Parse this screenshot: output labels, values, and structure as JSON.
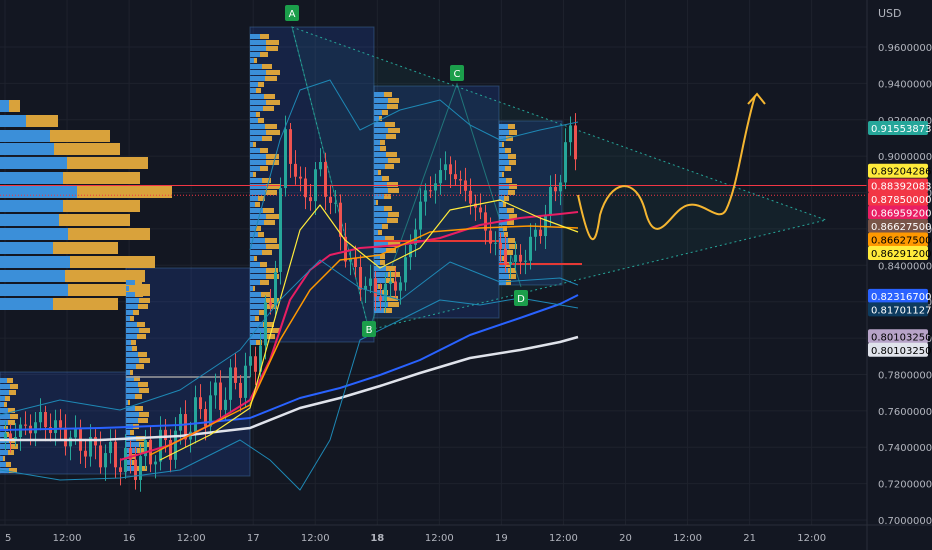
{
  "chart_data": {
    "type": "candlestick",
    "currency": "USD",
    "y_ticks": [
      "0.96000000",
      "0.94000000",
      "0.92000000",
      "0.90000000",
      "0.88000000",
      "0.86000000",
      "0.84000000",
      "0.82000000",
      "0.80000000",
      "0.78000000",
      "0.76000000",
      "0.74000000",
      "0.72000000",
      "0.70000000"
    ],
    "y_tick_values": [
      0.96,
      0.94,
      0.92,
      0.9,
      0.88,
      0.86,
      0.84,
      0.82,
      0.8,
      0.78,
      0.76,
      0.74,
      0.72,
      0.7
    ],
    "ylim": [
      0.699,
      0.968
    ],
    "x_ticks": [
      "5",
      "12:00",
      "16",
      "12:00",
      "17",
      "12:00",
      "18",
      "12:00",
      "19",
      "12:00",
      "20",
      "12:00",
      "21",
      "12:00"
    ],
    "x_tick_bold": [
      false,
      false,
      false,
      false,
      false,
      false,
      true,
      false,
      false,
      false,
      false,
      false,
      false,
      false
    ],
    "grid": true,
    "price_labels": [
      {
        "text": "0.91553873",
        "value": 0.9155,
        "color": "#26a69a",
        "fg": "#ffffff"
      },
      {
        "text": "0.89204286",
        "value": 0.892,
        "color": "#ffeb3b",
        "fg": "#000000"
      },
      {
        "text": "0.88392083",
        "value": 0.8839,
        "color": "#f23645",
        "fg": "#ffffff"
      },
      {
        "text": "0.87850000",
        "value": 0.8785,
        "color": "#f23645",
        "fg": "#ffffff"
      },
      {
        "text": "0.86959200",
        "value": 0.8696,
        "color": "#e91e63",
        "fg": "#ffffff"
      },
      {
        "text": "0.86627500",
        "value": 0.8663,
        "color": "#795548",
        "fg": "#ffffff"
      },
      {
        "text": "0.86627500",
        "value": 0.8663,
        "color": "#ff9800",
        "fg": "#000000"
      },
      {
        "text": "0.86291200",
        "value": 0.8629,
        "color": "#ffeb3b",
        "fg": "#000000"
      },
      {
        "text": "0.82316700",
        "value": 0.8232,
        "color": "#2962ff",
        "fg": "#ffffff"
      },
      {
        "text": "0.81701127",
        "value": 0.817,
        "color": "#0d3b5f",
        "fg": "#ffffff"
      },
      {
        "text": "0.80103250",
        "value": 0.801,
        "color": "#b7a3c8",
        "fg": "#000000"
      },
      {
        "text": "0.80103250",
        "value": 0.801,
        "color": "#e0e3eb",
        "fg": "#000000"
      }
    ],
    "pattern_points": [
      {
        "label": "A",
        "value": 0.97
      },
      {
        "label": "B",
        "value": 0.797
      },
      {
        "label": "C",
        "value": 0.939
      },
      {
        "label": "D",
        "value": 0.838
      }
    ]
  }
}
